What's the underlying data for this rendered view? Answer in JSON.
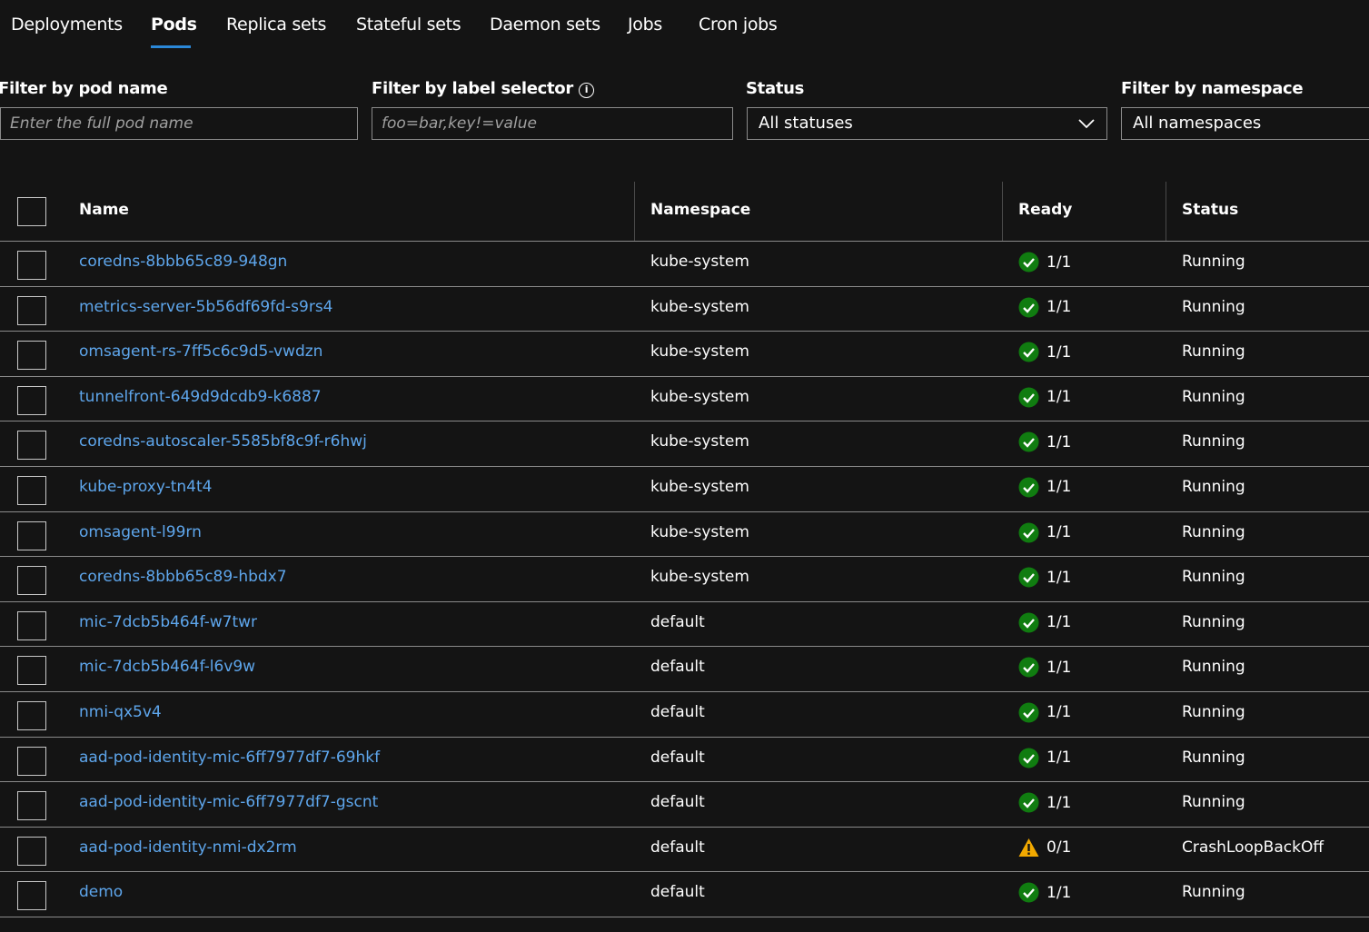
{
  "tabs": [
    {
      "label": "Deployments"
    },
    {
      "label": "Pods",
      "active": true
    },
    {
      "label": "Replica sets"
    },
    {
      "label": "Stateful sets"
    },
    {
      "label": "Daemon sets"
    },
    {
      "label": "Jobs"
    },
    {
      "label": "Cron jobs"
    }
  ],
  "filters": {
    "pod_name": {
      "label": "Filter by pod name",
      "placeholder": "Enter the full pod name",
      "value": ""
    },
    "label_selector": {
      "label": "Filter by label selector",
      "placeholder": "foo=bar,key!=value",
      "value": ""
    },
    "status": {
      "label": "Status",
      "value": "All statuses"
    },
    "namespace": {
      "label": "Filter by namespace",
      "value": "All namespaces"
    }
  },
  "table": {
    "columns": {
      "name": "Name",
      "namespace": "Namespace",
      "ready": "Ready",
      "status": "Status"
    },
    "rows": [
      {
        "name": "coredns-8bbb65c89-948gn",
        "namespace": "kube-system",
        "ready": "1/1",
        "ready_icon": "check-circle-icon",
        "status": "Running"
      },
      {
        "name": "metrics-server-5b56df69fd-s9rs4",
        "namespace": "kube-system",
        "ready": "1/1",
        "ready_icon": "check-circle-icon",
        "status": "Running"
      },
      {
        "name": "omsagent-rs-7ff5c6c9d5-vwdzn",
        "namespace": "kube-system",
        "ready": "1/1",
        "ready_icon": "check-circle-icon",
        "status": "Running"
      },
      {
        "name": "tunnelfront-649d9dcdb9-k6887",
        "namespace": "kube-system",
        "ready": "1/1",
        "ready_icon": "check-circle-icon",
        "status": "Running"
      },
      {
        "name": "coredns-autoscaler-5585bf8c9f-r6hwj",
        "namespace": "kube-system",
        "ready": "1/1",
        "ready_icon": "check-circle-icon",
        "status": "Running"
      },
      {
        "name": "kube-proxy-tn4t4",
        "namespace": "kube-system",
        "ready": "1/1",
        "ready_icon": "check-circle-icon",
        "status": "Running"
      },
      {
        "name": "omsagent-l99rn",
        "namespace": "kube-system",
        "ready": "1/1",
        "ready_icon": "check-circle-icon",
        "status": "Running"
      },
      {
        "name": "coredns-8bbb65c89-hbdx7",
        "namespace": "kube-system",
        "ready": "1/1",
        "ready_icon": "check-circle-icon",
        "status": "Running"
      },
      {
        "name": "mic-7dcb5b464f-w7twr",
        "namespace": "default",
        "ready": "1/1",
        "ready_icon": "check-circle-icon",
        "status": "Running"
      },
      {
        "name": "mic-7dcb5b464f-l6v9w",
        "namespace": "default",
        "ready": "1/1",
        "ready_icon": "check-circle-icon",
        "status": "Running"
      },
      {
        "name": "nmi-qx5v4",
        "namespace": "default",
        "ready": "1/1",
        "ready_icon": "check-circle-icon",
        "status": "Running"
      },
      {
        "name": "aad-pod-identity-mic-6ff7977df7-69hkf",
        "namespace": "default",
        "ready": "1/1",
        "ready_icon": "check-circle-icon",
        "status": "Running"
      },
      {
        "name": "aad-pod-identity-mic-6ff7977df7-gscnt",
        "namespace": "default",
        "ready": "1/1",
        "ready_icon": "check-circle-icon",
        "status": "Running"
      },
      {
        "name": "aad-pod-identity-nmi-dx2rm",
        "namespace": "default",
        "ready": "0/1",
        "ready_icon": "warning-icon",
        "status": "CrashLoopBackOff"
      },
      {
        "name": "demo",
        "namespace": "default",
        "ready": "1/1",
        "ready_icon": "check-circle-icon",
        "status": "Running"
      }
    ]
  },
  "colors": {
    "background": "#141414",
    "link": "#5ea6ec",
    "accent": "#2b88d8",
    "success": "#107c10",
    "warning": "#f2a900"
  }
}
